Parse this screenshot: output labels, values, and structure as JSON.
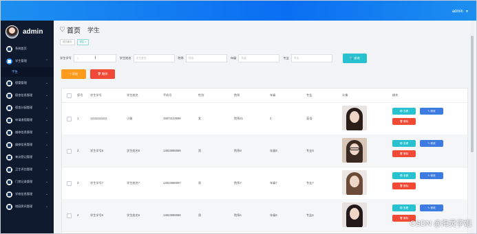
{
  "header": {
    "user": "admin",
    "caret": "▼"
  },
  "sidebar": {
    "brand_name": "admin",
    "items": [
      {
        "label": "系统首页",
        "chev": ""
      },
      {
        "label": "学生管理",
        "chev": "⌃"
      },
      {
        "label": "宿管管理",
        "chev": "⌄"
      },
      {
        "label": "宿舍信息管理",
        "chev": "⌄"
      },
      {
        "label": "宿舍分配管理",
        "chev": "⌄"
      },
      {
        "label": "申请退宿管理",
        "chev": "⌄"
      },
      {
        "label": "维修信息管理",
        "chev": "⌄"
      },
      {
        "label": "维修信息管理",
        "chev": "⌄"
      },
      {
        "label": "来访登记管理",
        "chev": "⌄"
      },
      {
        "label": "卫生评比管理",
        "chev": "⌄"
      },
      {
        "label": "门禁记录管理",
        "chev": "⌄"
      },
      {
        "label": "学校信息管理",
        "chev": "⌄"
      },
      {
        "label": "校园资讯管理",
        "chev": "⌄"
      }
    ],
    "sub_item": "学生"
  },
  "page": {
    "home": "首页",
    "section": "学生"
  },
  "tags": [
    "首页面页",
    "学生 ×"
  ],
  "filter": {
    "fields": [
      {
        "label": "学生学号",
        "placeholder": "·1",
        "w": 62
      },
      {
        "label": "学生姓名",
        "placeholder": "学生姓名",
        "w": 60
      },
      {
        "label": "院系",
        "placeholder": "院系",
        "w": 60
      },
      {
        "label": "年级",
        "placeholder": "年级",
        "w": 60
      },
      {
        "label": "专业",
        "placeholder": "专业",
        "w": 60
      }
    ],
    "cursor": "I",
    "search": "🔍 查询"
  },
  "actions": {
    "add": "+ 添加",
    "delete": "🗑 删除"
  },
  "table": {
    "headers": [
      "序号",
      "学生学号",
      "学生姓名",
      "手机号",
      "性别",
      "院系",
      "年级",
      "专业",
      "头像",
      "操作"
    ],
    "rows": [
      {
        "idx": "1",
        "sno": "111111111111",
        "name": "小雅",
        "phone": "15874123698",
        "sex": "女",
        "dept": "院系21",
        "grade": "2",
        "major": "英语",
        "photo": "#e9e4e2",
        "hair": "#2b1d18",
        "glasses": false
      },
      {
        "idx": "2",
        "sno": "学生学号8",
        "name": "学生姓名8",
        "phone": "13823888888",
        "sex": "男",
        "dept": "院系8",
        "grade": "年级8",
        "major": "专业8",
        "photo": "#d8c7b9",
        "hair": "#3a2a22",
        "glasses": true
      },
      {
        "idx": "3",
        "sno": "学生学号7",
        "name": "学生姓名7",
        "phone": "13823888887",
        "sex": "男",
        "dept": "院系7",
        "grade": "年级7",
        "major": "专业7",
        "photo": "#ece7e3",
        "hair": "#6b4a38",
        "glasses": false
      },
      {
        "idx": "4",
        "sno": "学生学号6",
        "name": "学生姓名6",
        "phone": "13823888886",
        "sex": "男",
        "dept": "院系6",
        "grade": "年级6",
        "major": "专业6",
        "photo": "#e6e1de",
        "hair": "#24191a",
        "glasses": false
      }
    ],
    "btn_view": "👁 查看",
    "btn_edit": "✎ 修改",
    "btn_del": "🗑 删除"
  },
  "watermark": "CSDN @海灵学姐"
}
